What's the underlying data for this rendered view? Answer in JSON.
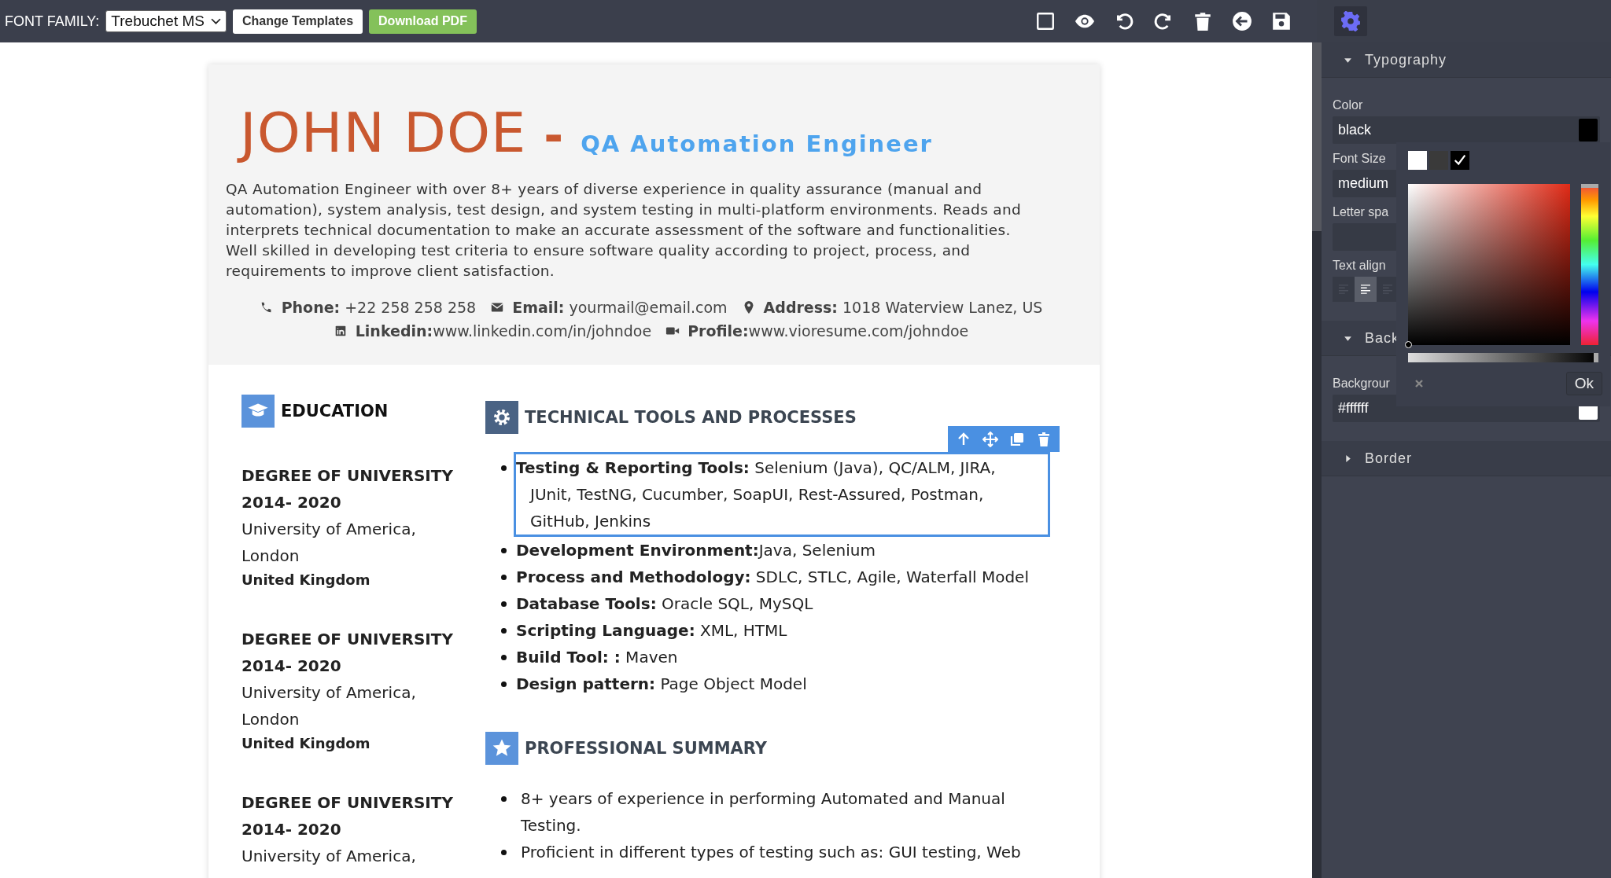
{
  "toolbar": {
    "font_label": "FONT FAMILY:",
    "font_select": {
      "value": "Trebuchet MS"
    },
    "buttons": [
      {
        "label": "Change Templates",
        "kind": "plain"
      },
      {
        "label": "Download PDF",
        "kind": "primary"
      }
    ],
    "settings_tab": {
      "selected": true
    }
  },
  "resume": {
    "name": "JOHN DOE",
    "dash": "-",
    "title": "QA Automation Engineer",
    "summary": "QA Automation Engineer with over 8+ years of diverse experience in quality assurance (manual and automation), system analysis, test design, and system testing in multi-platform environments. Reads and interprets technical documentation to make an accurate assessment of the software and functionalities. Well skilled in developing test criteria to ensure software quality according to project, process, and requirements to improve client satisfaction.",
    "contact_rows": [
      [
        {
          "kind": "phone",
          "text": "**Phone:** +22 258 258 258"
        },
        {
          "kind": "email",
          "text": "**Email:** yourmail@email.com"
        },
        {
          "kind": "address",
          "text": "**Address:** 1018 Waterview Lanez, US"
        }
      ],
      [
        {
          "kind": "linkedin",
          "text": "**Linkedin:**www.linkedin.com/in/johndoe"
        },
        {
          "kind": "profile",
          "text": "**Profile:**www.vioresume.com/johndoe"
        }
      ]
    ],
    "education": {
      "heading": "EDUCATION",
      "entries": [
        {
          "degree": "DEGREE OF UNIVERSITY",
          "years": "2014- 2020",
          "school": "University of America, London",
          "country": "United Kingdom"
        },
        {
          "degree": "DEGREE OF UNIVERSITY",
          "years": "2014- 2020",
          "school": "University of America, London",
          "country": "United Kingdom"
        },
        {
          "degree": "DEGREE OF UNIVERSITY",
          "years": "2014- 2020",
          "school": "University of America,"
        }
      ]
    },
    "tools": {
      "heading": "TECHNICAL TOOLS AND PROCESSES",
      "items": [
        {
          "text": "**Testing & Reporting Tools:** Selenium (Java), QC/ALM, JIRA, JUnit, TestNG, Cucumber, SoapUI, Rest-Assured, Postman, GitHub, Jenkins",
          "selected": true
        },
        {
          "text": "**Development Environment:**Java, Selenium",
          "selected": false
        },
        {
          "text": "**Process and Methodology:** SDLC, STLC, Agile, Waterfall Model",
          "selected": false
        },
        {
          "text": "**Database Tools:** Oracle SQL, MySQL",
          "selected": false
        },
        {
          "text": "**Scripting Language:** XML, HTML",
          "selected": false
        },
        {
          "text": "**Build Tool: :** Maven",
          "selected": false
        },
        {
          "text": "**Design pattern:** Page Object Model",
          "selected": false
        }
      ]
    },
    "professional_summary": {
      "heading": "PROFESSIONAL SUMMARY",
      "items": [
        "8+ years of experience in performing Automated and Manual Testing.",
        "Proficient in different types of testing such as: GUI testing, Web"
      ]
    }
  },
  "style_panel": {
    "sections": [
      {
        "title": "Typography",
        "expanded": true,
        "fields": [
          {
            "kind": "color",
            "label": "Color",
            "value": "black"
          },
          {
            "kind": "text",
            "label": "Font Size",
            "value": "medium"
          },
          {
            "kind": "text",
            "label": "Letter spa"
          },
          {
            "kind": "align",
            "label": "Text align",
            "options": [
              {
                "selected": false
              },
              {
                "selected": true
              },
              {
                "selected": false
              }
            ]
          }
        ]
      },
      {
        "title": "Back",
        "expanded": true,
        "fields": [
          {
            "kind": "color",
            "label": "Backgrour",
            "value": "#ffffff"
          }
        ]
      },
      {
        "title": "Border",
        "expanded": false
      }
    ]
  },
  "color_picker": {
    "swatches": [
      {
        "color": "#ffffff",
        "selected": false
      },
      {
        "color": "#3a3a3a",
        "selected": false
      },
      {
        "color": "#000000",
        "selected": true
      }
    ],
    "hue": {
      "level": 0
    },
    "alpha": {
      "level": 1
    },
    "ok": "Ok"
  }
}
